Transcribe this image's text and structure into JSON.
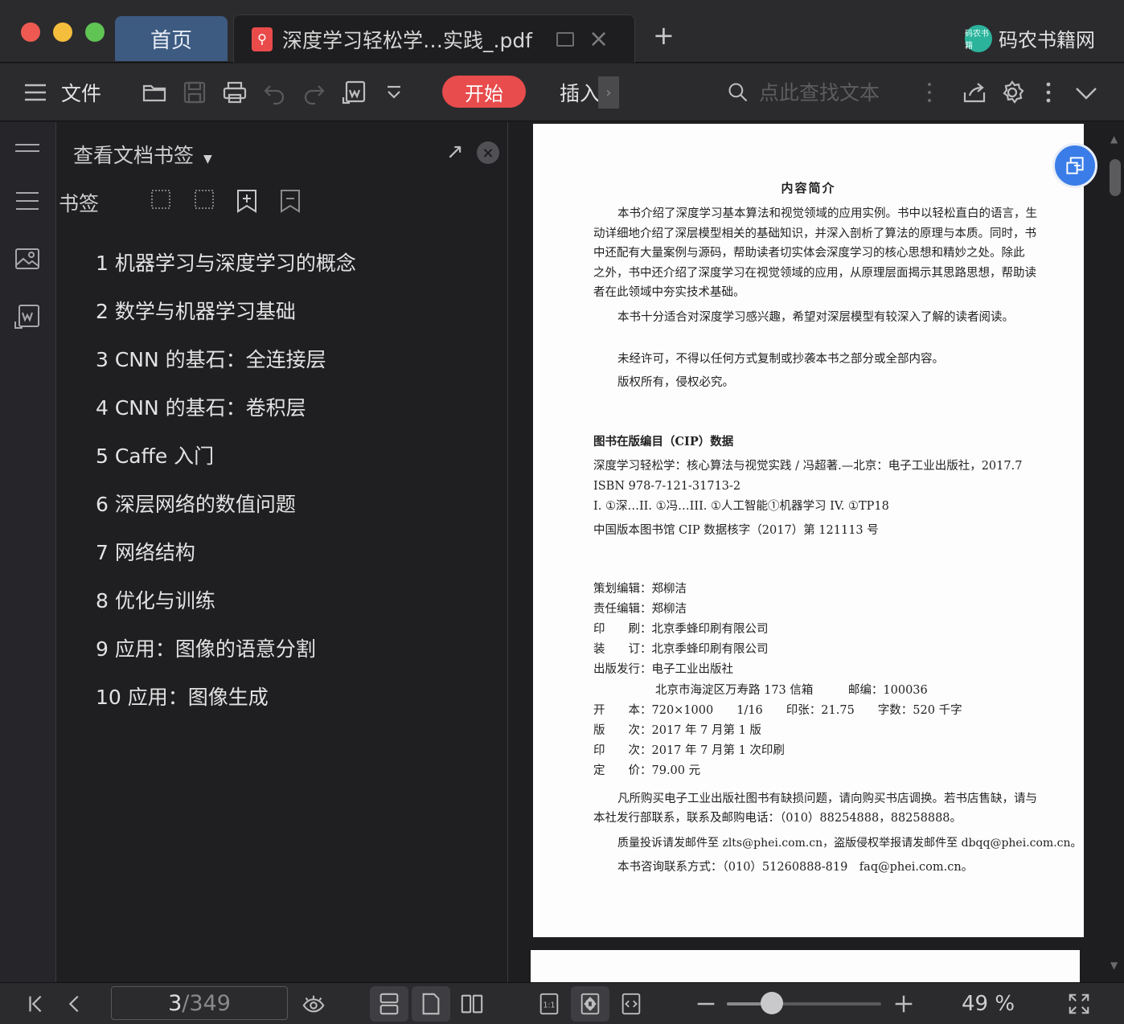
{
  "window": {
    "tabs": {
      "home": "首页",
      "document": "深度学习轻松学…实践_.pdf"
    },
    "brand": {
      "logo_text": "码农书籍",
      "name": "码农书籍网"
    }
  },
  "toolbar": {
    "file_label": "文件",
    "start_label": "开始",
    "insert_label": "插入",
    "search": {
      "placeholder": "点此查找文本",
      "value": ""
    }
  },
  "bookmarks_panel": {
    "title": "查看文档书签",
    "section_label": "书签",
    "items": [
      "1 机器学习与深度学习的概念",
      "2 数学与机器学习基础",
      "3 CNN 的基石：全连接层",
      "4 CNN 的基石：卷积层",
      "5 Caffe 入门",
      "6 深层网络的数值问题",
      "7 网络结构",
      "8 优化与训练",
      "9 应用：图像的语意分割",
      "10 应用：图像生成"
    ]
  },
  "page": {
    "heading": "内容简介",
    "intro": [
      "本书介绍了深度学习基本算法和视觉领域的应用实例。书中以轻松直白的语言，生",
      "动详细地介绍了深层模型相关的基础知识，并深入剖析了算法的原理与本质。同时，书",
      "中还配有大量案例与源码，帮助读者切实体会深度学习的核心思想和精妙之处。除此",
      "之外，书中还介绍了深度学习在视觉领域的应用，从原理层面揭示其思路思想，帮助读",
      "者在此领域中夯实技术基础。"
    ],
    "audience": "本书十分适合对深度学习感兴趣，希望对深层模型有较深入了解的读者阅读。",
    "copyright": [
      "未经许可，不得以任何方式复制或抄袭本书之部分或全部内容。",
      "版权所有，侵权必究。"
    ],
    "cip_title": "图书在版编目（CIP）数据",
    "cip_lines": [
      "深度学习轻松学：核心算法与视觉实践 / 冯超著.—北京：电子工业出版社，2017.7",
      "ISBN 978-7-121-31713-2",
      "I. ①深…II. ①冯…III. ①人工智能①机器学习 IV. ①TP18",
      "中国版本图书馆 CIP 数据核字（2017）第 121113 号"
    ],
    "credits": [
      "策划编辑：郑柳洁",
      "责任编辑：郑柳洁",
      "印　　刷：北京季蜂印刷有限公司",
      "装　　订：北京季蜂印刷有限公司",
      "出版发行：电子工业出版社",
      "北京市海淀区万寿路 173 信箱　　　邮编：100036",
      "开　　本：720×1000　　1/16　　印张：21.75　　字数：520 千字",
      "版　　次：2017 年 7 月第 1 版",
      "印　　次：2017 年 7 月第 1 次印刷",
      "定　　价：79.00 元"
    ],
    "notice": [
      "凡所购买电子工业出版社图书有缺损问题，请向购买书店调换。若书店售缺，请与",
      "本社发行部联系，联系及邮购电话：（010）88254888，88258888。",
      "质量投诉请发邮件至 zlts@phei.com.cn，盗版侵权举报请发邮件至 dbqq@phei.com.cn。",
      "本书咨询联系方式：（010）51260888-819　faq@phei.com.cn。"
    ]
  },
  "statusbar": {
    "current_page": "3",
    "separator": "/",
    "total_pages": "349",
    "zoom_fraction": 0.29,
    "zoom_label": "49 %"
  },
  "colors": {
    "accent_red": "#e84c4c",
    "tab_blue": "#3d5a80",
    "float_blue": "#3a7de8"
  }
}
